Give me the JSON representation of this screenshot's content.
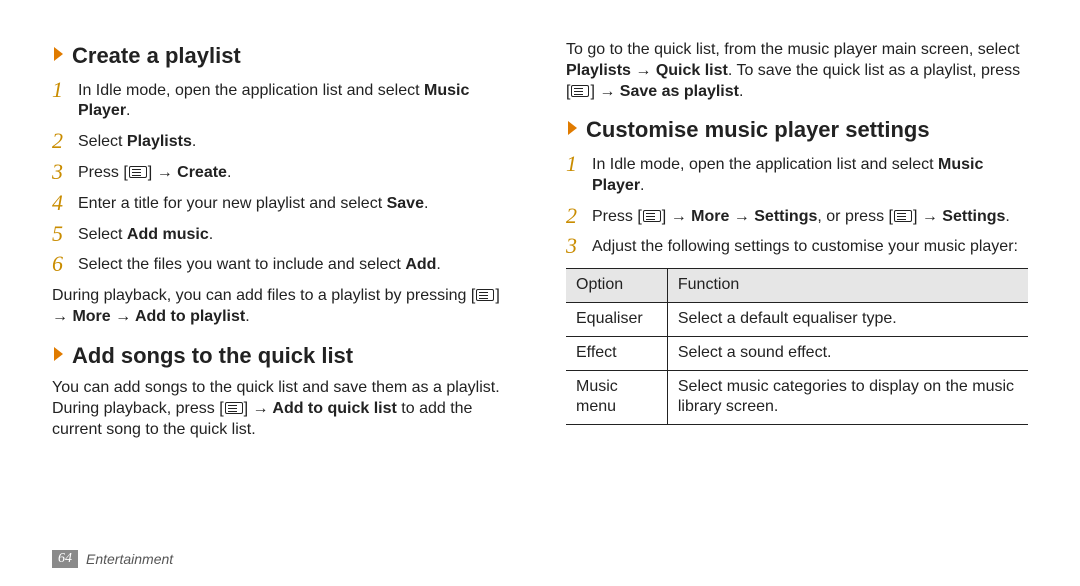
{
  "icons": {
    "chevron_color": "#e07b00"
  },
  "footer": {
    "page": "64",
    "section": "Entertainment"
  },
  "left": {
    "create": {
      "title": "Create a playlist",
      "steps": [
        {
          "n": "1",
          "pre": "In Idle mode, open the application list and select ",
          "bold": "Music Player",
          "post": "."
        },
        {
          "n": "2",
          "pre": "Select ",
          "bold": "Playlists",
          "post": "."
        },
        {
          "n": "3",
          "pre": "Press [",
          "icon": true,
          "mid": "] → ",
          "bold": "Create",
          "post": "."
        },
        {
          "n": "4",
          "pre": "Enter a title for your new playlist and select ",
          "bold": "Save",
          "post": "."
        },
        {
          "n": "5",
          "pre": "Select ",
          "bold": "Add music",
          "post": "."
        },
        {
          "n": "6",
          "pre": "Select the files you want to include and select ",
          "bold": "Add",
          "post": "."
        }
      ],
      "after_pre": "During playback, you can add files to a playlist by pressing [",
      "after_mid": "] ",
      "after_bold": "→ More → Add to playlist",
      "after_post": "."
    },
    "quick": {
      "title": "Add songs to the quick list",
      "p_pre": "You can add songs to the quick list and save them as a playlist. During playback, press [",
      "p_mid": "] ",
      "p_bold": "→ Add to quick list",
      "p_post": " to add the current song to the quick list."
    }
  },
  "right": {
    "intro_pre": "To go to the quick list, from the music player main screen, select ",
    "intro_b1": "Playlists → Quick list",
    "intro_mid": ". To save the quick list as a playlist, press [",
    "intro_mid2": "] ",
    "intro_b2": "→ Save as playlist",
    "intro_post": ".",
    "custom": {
      "title": "Customise music player settings",
      "step1_pre": "In Idle mode, open the application list and select ",
      "step1_bold": "Music Player",
      "step1_post": ".",
      "step2_pre": "Press [",
      "step2_mid1": "] ",
      "step2_b1": "→ More → Settings",
      "step2_mid2": ", or press [",
      "step2_mid3": "] → ",
      "step2_b2": "Settings",
      "step2_post": ".",
      "step3": "Adjust the following settings to customise your music player:",
      "nums": {
        "n1": "1",
        "n2": "2",
        "n3": "3"
      }
    },
    "table": {
      "head_option": "Option",
      "head_function": "Function",
      "rows": [
        {
          "opt": "Equaliser",
          "fn": "Select a default equaliser type."
        },
        {
          "opt": "Effect",
          "fn": "Select a sound effect."
        },
        {
          "opt": "Music menu",
          "fn": "Select music categories to display on the music library screen."
        }
      ]
    }
  }
}
